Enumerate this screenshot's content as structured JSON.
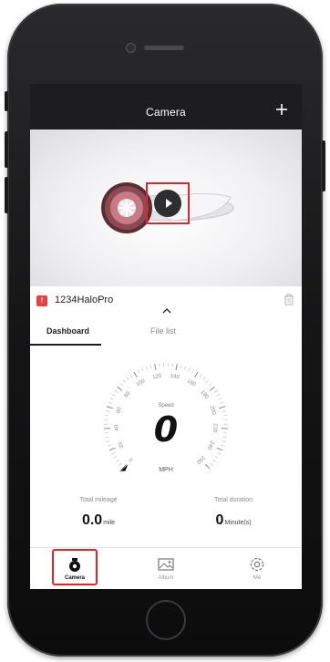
{
  "header": {
    "title": "Camera",
    "add_icon": "plus-icon"
  },
  "preview": {
    "play_icon": "play-icon"
  },
  "device": {
    "badge": "!",
    "name": "1234HaloPro",
    "delete_icon": "trash-icon"
  },
  "tabs": [
    {
      "label": "Dashboard",
      "active": true
    },
    {
      "label": "File list",
      "active": false
    }
  ],
  "gauge": {
    "speed_label": "Speed",
    "speed_value": "0",
    "unit": "MPH",
    "tick_labels": [
      "0",
      "20",
      "40",
      "60",
      "80",
      "100",
      "120",
      "140",
      "160",
      "180",
      "200",
      "220",
      "240",
      "260"
    ]
  },
  "stats": {
    "mileage_label": "Total mileage",
    "mileage_value": "0.0",
    "mileage_unit": "mile",
    "duration_label": "Total duration",
    "duration_value": "0",
    "duration_unit": "Minute(s)"
  },
  "bottom_nav": [
    {
      "label": "Camera",
      "icon": "camera-icon",
      "active": true
    },
    {
      "label": "Album",
      "icon": "album-icon",
      "active": false
    },
    {
      "label": "Me",
      "icon": "gear-icon",
      "active": false
    }
  ],
  "colors": {
    "header_bg": "#1d1d1f",
    "highlight": "#e0242c",
    "badge": "#e6403f"
  }
}
